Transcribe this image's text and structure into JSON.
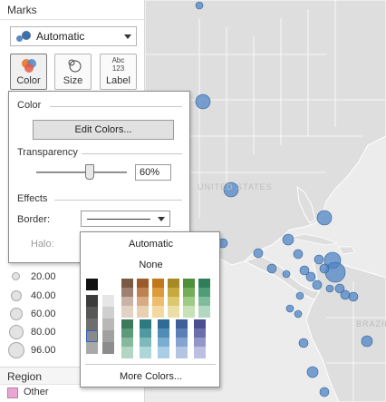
{
  "marks": {
    "title": "Marks",
    "mark_type": "Automatic",
    "shelf_buttons": [
      {
        "label": "Color",
        "icon": "color-icon"
      },
      {
        "label": "Size",
        "icon": "size-icon"
      },
      {
        "label": "Label",
        "icon": "label-icon",
        "icon_text_top": "Abc",
        "icon_text_bottom": "123"
      }
    ]
  },
  "color_popup": {
    "color_label": "Color",
    "edit_colors_label": "Edit Colors...",
    "transparency_label": "Transparency",
    "transparency_value": "60%",
    "transparency_fraction": 0.6,
    "effects_label": "Effects",
    "border_label": "Border:",
    "halo_label": "Halo:"
  },
  "palette": {
    "automatic_label": "Automatic",
    "none_label": "None",
    "more_colors_label": "More Colors...",
    "selected_swatch": "gray-column-row-5",
    "gray_columns": [
      [
        "#111111",
        "#3c3c3c",
        "#575757",
        "#6e6e6e",
        "#8a8a8a",
        "#a9a9a9"
      ],
      [
        "#ffffff",
        "#e6e6e6",
        "#cfcfcf",
        "#b8b8b8",
        "#a1a1a1",
        "#8c8c8c"
      ]
    ],
    "hue_columns_top": [
      [
        "#7a5a44",
        "#a08070",
        "#c8b4a6",
        "#e1d2c4"
      ],
      [
        "#9c5a2a",
        "#bf8150",
        "#d9ab82",
        "#ead0b2"
      ],
      [
        "#c3771b",
        "#dc9a3c",
        "#ebbd6c",
        "#f3d9a0"
      ],
      [
        "#a88a24",
        "#c7aa3f",
        "#dcc86e",
        "#ebdfa6"
      ],
      [
        "#4f8f3a",
        "#73ad5a",
        "#9ccb85",
        "#c6e2b6"
      ],
      [
        "#2e7f59",
        "#4f9d77",
        "#7fbc9b",
        "#b2d8c2"
      ]
    ],
    "hue_columns_bottom": [
      [
        "#3d7a5c",
        "#5c9a7a",
        "#86b89e",
        "#b3d5c3"
      ],
      [
        "#2d7a80",
        "#4f9aa0",
        "#7db9bd",
        "#aed6d8"
      ],
      [
        "#2f6b95",
        "#4f8cb6",
        "#7aaed1",
        "#a9cde6"
      ],
      [
        "#3d5f9a",
        "#5b80b8",
        "#86a4d0",
        "#b3c5e3"
      ],
      [
        "#4a4f8f",
        "#6b70ad",
        "#9397c7",
        "#bcbfe0"
      ]
    ]
  },
  "size_legend": {
    "values": [
      "20.00",
      "40.00",
      "60.00",
      "80.00",
      "96.00"
    ]
  },
  "region_legend": {
    "title": "Region",
    "items": [
      {
        "label": "Other",
        "color": "#e8a6d4"
      }
    ]
  },
  "map": {
    "land_color": "#dedede",
    "water_color": "#ececec",
    "point_color": "#4f86c6",
    "labels": [
      "UNITED STATES",
      "BRAZIL"
    ]
  }
}
